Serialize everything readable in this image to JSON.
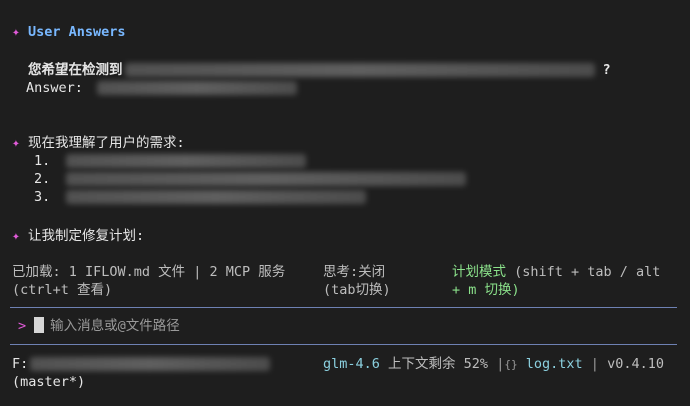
{
  "user_answers": {
    "title": "User Answers",
    "question_prefix": "您希望在检测到",
    "question_suffix": "?",
    "answer_label": "Answer:"
  },
  "understanding": {
    "title": "现在我理解了用户的需求:",
    "items": [
      {
        "num": "1."
      },
      {
        "num": "2."
      },
      {
        "num": "3."
      }
    ]
  },
  "plan": {
    "title": "让我制定修复计划:"
  },
  "status": {
    "loaded_text": "已加载: 1 IFLOW.md 文件 | 2 MCP 服务",
    "view_hint": "(ctrl+t 查看)",
    "thinking": "思考:关闭",
    "thinking_hint": "(tab切换)",
    "plan_mode": "计划模式",
    "plan_mode_hint_1": "(shift + tab / alt",
    "plan_mode_hint_2": "+ m 切换)"
  },
  "input": {
    "prompt_symbol": ">",
    "placeholder": "输入消息或@文件路径"
  },
  "footer": {
    "path_prefix": "F:",
    "branch": "(master*)",
    "model": "glm-4.6",
    "context_label": "上下文剩余 52%",
    "sep1": "|",
    "file_icon": "{}",
    "log_file": "log.txt",
    "sep2": "|",
    "version": "v0.4.10"
  },
  "colors": {
    "background": "#1e1e1e",
    "sparkle": "#e05ad8",
    "title_blue": "#79b8ff",
    "plan_mode_green": "#8be28b",
    "link_teal": "#8bd0df",
    "separator": "#8aa3e6"
  },
  "icons": {
    "sparkle": "sparkle-icon",
    "file": "braces-icon"
  }
}
